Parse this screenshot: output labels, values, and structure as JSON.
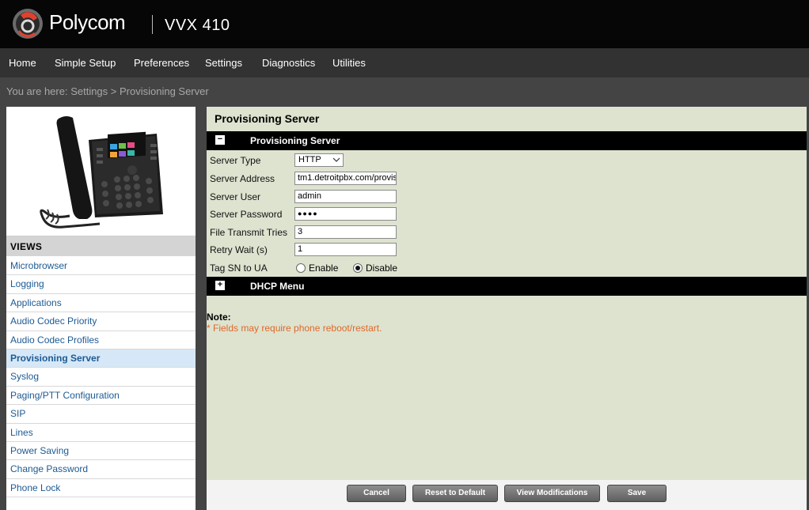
{
  "header": {
    "brand": "Polycom",
    "model": "VVX 410",
    "logo_icon": "polycom-logo-icon",
    "accent_color": "#e0402f"
  },
  "nav": {
    "items": [
      "Home",
      "Simple Setup",
      "Preferences",
      "Settings",
      "Diagnostics",
      "Utilities"
    ]
  },
  "breadcrumb": "You are here: Settings > Provisioning Server",
  "sidebar": {
    "image_icon": "desk-phone-icon",
    "views_title": "VIEWS",
    "items": [
      "Microbrowser",
      "Logging",
      "Applications",
      "Audio Codec Priority",
      "Audio Codec Profiles",
      "Provisioning Server",
      "Syslog",
      "Paging/PTT Configuration",
      "SIP",
      "Lines",
      "Power Saving",
      "Change Password",
      "Phone Lock"
    ],
    "active_index": 5
  },
  "main": {
    "title": "Provisioning Server",
    "section1": {
      "label": "Provisioning Server",
      "toggle": "−"
    },
    "section2": {
      "label": "DHCP Menu",
      "toggle": "+"
    },
    "fields": {
      "server_type": {
        "label": "Server Type",
        "value": "HTTP"
      },
      "server_address": {
        "label": "Server Address",
        "value": "tm1.detroitpbx.com/provis"
      },
      "server_user": {
        "label": "Server User",
        "value": "admin"
      },
      "server_password": {
        "label": "Server Password",
        "value": "●●●●"
      },
      "file_transmit_tries": {
        "label": "File Transmit Tries",
        "value": "3"
      },
      "retry_wait": {
        "label": "Retry Wait (s)",
        "value": "1"
      },
      "tag_sn": {
        "label": "Tag SN to UA",
        "option_enable": "Enable",
        "option_disable": "Disable",
        "selected": "Disable"
      }
    },
    "note_title": "Note:",
    "note_text": "* Fields may require phone reboot/restart.",
    "note_color": "#e0682a"
  },
  "buttons": {
    "cancel": "Cancel",
    "reset": "Reset to Default",
    "view_mods": "View Modifications",
    "save": "Save"
  }
}
